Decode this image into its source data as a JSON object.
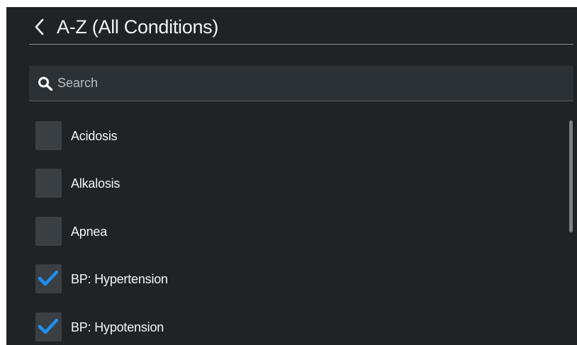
{
  "header": {
    "title": "A-Z (All Conditions)",
    "back_icon": "chevron-left-icon"
  },
  "search": {
    "placeholder": "Search",
    "value": "",
    "icon": "search-icon"
  },
  "conditions": [
    {
      "label": "Acidosis",
      "checked": false
    },
    {
      "label": "Alkalosis",
      "checked": false
    },
    {
      "label": "Apnea",
      "checked": false
    },
    {
      "label": "BP: Hypertension",
      "checked": true
    },
    {
      "label": "BP: Hypotension",
      "checked": true
    }
  ],
  "colors": {
    "background": "#1f2326",
    "checkbox": "#3a3f43",
    "check_accent": "#1e8ff0",
    "text": "#f4f4f4"
  }
}
